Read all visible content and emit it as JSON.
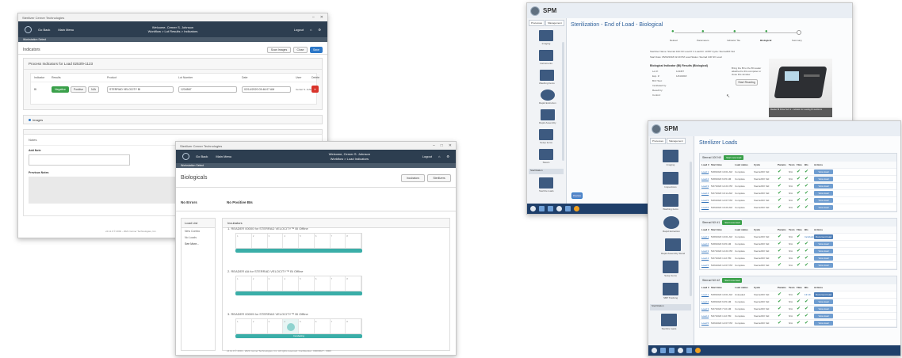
{
  "win1": {
    "app_title": "Sterilizer Cerner Technologies",
    "nav_back": "Go Back",
    "nav_main": "Main Menu",
    "welcome": "Welcome, Cerner S. Johnson",
    "breadcrumb": "Workflow > Lot Results > Indicators",
    "logout": "Logout",
    "subbar": "Workstation Select",
    "section": "Indicators",
    "actions": [
      "Scan Images",
      "Close",
      "Save"
    ],
    "panel_title": "Process Indicators for Load 0253/9-1123",
    "columns": [
      "Indicator",
      "Results",
      "Product",
      "Lot Number",
      "Date",
      "User",
      "Delete"
    ],
    "row": {
      "indicator": "BI",
      "results": [
        "Negative",
        "Positive",
        "N/A"
      ],
      "product": "STERRAD VELOCITY BI",
      "lot": "1234567",
      "date": "02/14/2020 03:46:07 AM",
      "user": "Cerner S. Johnson"
    },
    "images_toggle": "Images",
    "notes_title": "Notes",
    "add_note": "Add Note",
    "previous_notes": "Previous Notes",
    "footer": "v2.11.0 © 2001 - 2021 Cerner Technologies, Inc."
  },
  "win2": {
    "app_title": "Sterilizer Cerner Technologies",
    "nav_back": "Go Back",
    "nav_main": "Main Menu",
    "welcome": "Welcome, Cerner S. Johnson",
    "breadcrumb": "Workflow > Load Indicators",
    "logout": "Logout",
    "subbar": "Workstation Select",
    "page_title": "Biologicals",
    "header_buttons": [
      "Incubators",
      "Sterilizers"
    ],
    "no_errors": "No Errors",
    "no_positive": "No Positive BIs",
    "load_list_title": "Load List",
    "load_list": [
      "New Combo",
      "No Loads",
      "See More..."
    ],
    "incubators_title": "Incubators",
    "readers": [
      {
        "name": "1. READER 00000 for STERRAD VELOCITY™ BI Offline",
        "wells": [
          "1",
          "2",
          "3",
          "4",
          "5",
          "6",
          "7",
          "8"
        ],
        "active": -1
      },
      {
        "name": "2. READER AA for STERRAD VELOCITY™ BI Offline",
        "wells": [
          "1",
          "2",
          "3",
          "4",
          "5",
          "6",
          "7",
          "8"
        ],
        "active": -1
      },
      {
        "name": "3. READER 00009 for STERRAD VELOCITY™ BI Offline",
        "wells": [
          "1",
          "2",
          "3",
          "4",
          "5",
          "6",
          "7",
          "8"
        ],
        "active": 3,
        "bar_label": "Incubating"
      }
    ],
    "footer": "v2.11.0 © 2001 - 2021 Cerner Technologies, Inc. All rights reserved. Confidential - 00000027 - 0000"
  },
  "win3": {
    "app": "SPM",
    "tabs": [
      "Processes",
      "Management"
    ],
    "side_items": [
      "Imaging",
      "Instruments",
      "Washing Items",
      "Rapid Extinction",
      "Rapid Assembly",
      "Setup items",
      "Steam"
    ],
    "side_section": "Sterilization",
    "side_last": "Sterilize loads",
    "title": "Sterilization - End of Load - Biological",
    "steps": [
      "Reload",
      "Parameters",
      "Indicator Tile",
      "Biological",
      "Summary"
    ],
    "info_line1": "Sterilizer Name: Sterrad 100 NX    Load #: 3    Load ID: 14787    Cycle: SterradNX Std",
    "info_line2": "Start Date: 05/03/2018 02:20 PM    Load Status: Sterrad 100 NX Load",
    "bi_heading": "Biological Indicator (BI) Results (Biological)",
    "fields": [
      {
        "label": "Lot #:",
        "value": "123457"
      },
      {
        "label": "Exp. #:",
        "value": "1/04/2018"
      },
      {
        "label": "BI # Test:",
        "value": ""
      },
      {
        "label": "Incubated by:",
        "value": ""
      },
      {
        "label": "Result by:",
        "value": ""
      },
      {
        "label": "Control:",
        "value": ""
      }
    ],
    "prompt": "Bring the BI to the BI reader attached to this computer or close this window",
    "start_button": "Start Reading",
    "caption": "Reader BI Pulse Tech 2 - Indicator for reading BI sterilizers",
    "link": "Infosis.a-bi.net/1/3",
    "back_button": "Previous"
  },
  "win4": {
    "app": "SPM",
    "tabs": [
      "Processes",
      "Management"
    ],
    "side_items": [
      "Imaging",
      "Inspections",
      "Washing items",
      "Rapid Extraction",
      "Rapid Assembly Stand",
      "Setup items",
      "SBP Tracking"
    ],
    "side_section": "Sterilization",
    "side_last": "Sterilize loads",
    "title": "Sterilizer Loads",
    "columns": [
      "Load #",
      "Start time",
      "Load status",
      "Cycle",
      "Params",
      "Tests",
      "Files",
      "BIs",
      "Actions"
    ],
    "groups": [
      {
        "name": "Sterrad 100 NX",
        "button": "Start new load",
        "rows": [
          {
            "load": "Load 1",
            "time": "5/28/2020 10:01 AM",
            "status": "Complete",
            "cycle": "SterradNX Std",
            "params": "✔",
            "tests": "N/A",
            "files": "✔",
            "bis": "✔",
            "action": "View load"
          },
          {
            "load": "Load 2",
            "time": "5/28/2020 9:45 AM",
            "status": "Complete",
            "cycle": "SterradNX Std",
            "params": "✔",
            "tests": "N/A",
            "files": "✔",
            "bis": "✔",
            "action": "View load"
          },
          {
            "load": "Load 3",
            "time": "5/27/2020 12:21 PM",
            "status": "Complete",
            "cycle": "SterradNX Std",
            "params": "✔",
            "tests": "N/A",
            "files": "✔",
            "bis": "✔",
            "action": "View load"
          },
          {
            "load": "Load 4",
            "time": "5/27/2020 10:14 AM",
            "status": "Complete",
            "cycle": "SterradNX Std",
            "params": "✔",
            "tests": "N/A",
            "files": "✔",
            "bis": "✔",
            "action": "View load"
          },
          {
            "load": "Load 5",
            "time": "5/26/2020 12:07 PM",
            "status": "Complete",
            "cycle": "SterradNX Std",
            "params": "✔",
            "tests": "N/A",
            "files": "✔",
            "bis": "✔",
            "action": "View load"
          },
          {
            "load": "Load 6",
            "time": "5/26/2020 10:20 AM",
            "status": "Complete",
            "cycle": "SterradNX Std",
            "params": "✔",
            "tests": "N/A",
            "files": "✔",
            "bis": "✔",
            "action": "View load"
          }
        ]
      },
      {
        "name": "Sterrad NX #1",
        "button": "Start new load",
        "rows": [
          {
            "load": "Load 1",
            "time": "5/28/2020 10:01 AM",
            "status": "Complete",
            "cycle": "SterradNX Std",
            "params": "✔",
            "tests": "N/A",
            "files": "✔",
            "bis": "Incubating",
            "action": "Document load"
          },
          {
            "load": "Load 2",
            "time": "5/28/2020 9:45 AM",
            "status": "Complete",
            "cycle": "SterradNX Std",
            "params": "✔",
            "tests": "N/A",
            "files": "✔",
            "bis": "✔",
            "action": "View load"
          },
          {
            "load": "Load 3",
            "time": "5/27/2020 12:21 PM",
            "status": "Complete",
            "cycle": "SterradNX Std",
            "params": "✔",
            "tests": "N/A",
            "files": "✔",
            "bis": "✔",
            "action": "View load"
          },
          {
            "load": "Load 4",
            "time": "5/27/2020 1:22 PM",
            "status": "Complete",
            "cycle": "SterradNX Std",
            "params": "✔",
            "tests": "N/A",
            "files": "✔",
            "bis": "✔",
            "action": "View load"
          },
          {
            "load": "Load 5",
            "time": "5/26/2020 12:07 PM",
            "status": "Complete",
            "cycle": "SterradNX Std",
            "params": "✔",
            "tests": "N/A",
            "files": "✔",
            "bis": "✔",
            "action": "View load"
          }
        ]
      },
      {
        "name": "Sterrad NX #2",
        "button": "Start new load",
        "rows": [
          {
            "load": "Load 1",
            "time": "5/28/2020 10:01 AM",
            "status": "Unloaded",
            "cycle": "SterradNX Std",
            "params": "✔",
            "tests": "N/A",
            "files": "✔",
            "bis": "13:19",
            "action": "Document load"
          },
          {
            "load": "Load 2",
            "time": "5/28/2020 9:45 AM",
            "status": "Complete",
            "cycle": "SterradNX Std",
            "params": "✔",
            "tests": "N/A",
            "files": "✔",
            "bis": "✔",
            "action": "View load"
          },
          {
            "load": "Load 3",
            "time": "5/27/2020 7:10 AM",
            "status": "Complete",
            "cycle": "SterradNX Std",
            "params": "✔",
            "tests": "N/A",
            "files": "✔",
            "bis": "✔",
            "action": "View load"
          },
          {
            "load": "Load 4",
            "time": "5/27/2020 1:22 PM",
            "status": "Complete",
            "cycle": "SterradNX Std",
            "params": "✔",
            "tests": "N/A",
            "files": "✔",
            "bis": "✔",
            "action": "View load"
          },
          {
            "load": "Load 5",
            "time": "5/26/2020 12:07 PM",
            "status": "Complete",
            "cycle": "SterradNX Std",
            "params": "✔",
            "tests": "N/A",
            "files": "✔",
            "bis": "✔",
            "action": "View load"
          }
        ]
      }
    ]
  },
  "colors": {
    "nav_dark": "#2d3e50",
    "accent_blue": "#2d78c8",
    "success_green": "#3aa04a",
    "teal_bar": "#3aaea8",
    "danger_red": "#d9342b"
  }
}
